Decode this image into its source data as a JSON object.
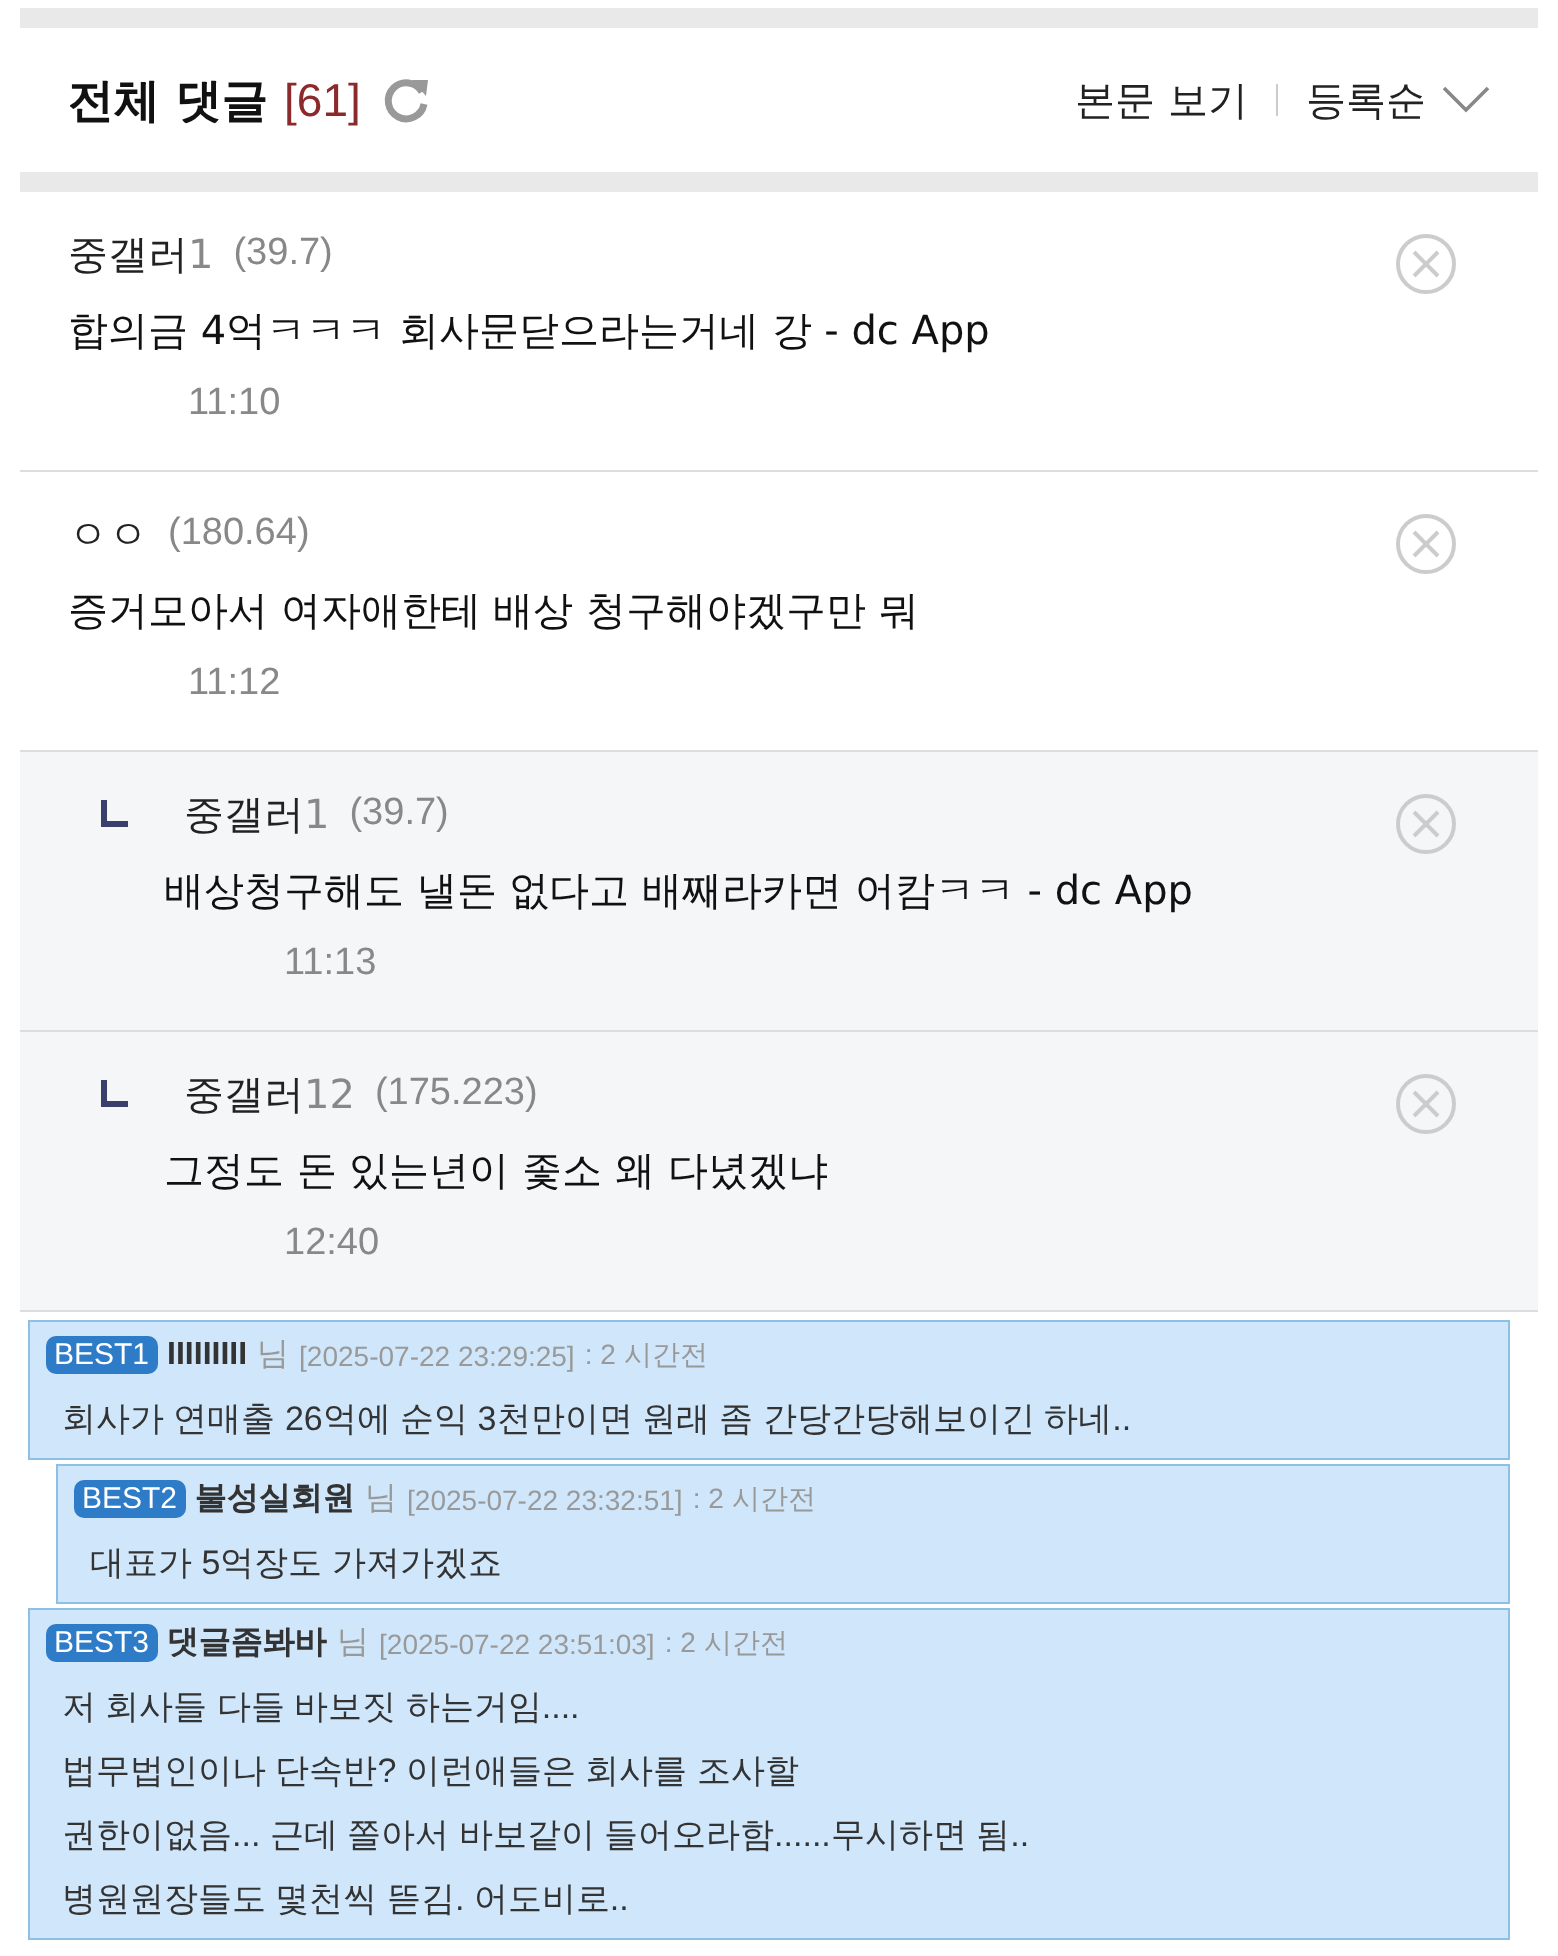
{
  "header": {
    "title": "전체 댓글",
    "count": "[61]",
    "view_post": "본문 보기",
    "sort": "등록순"
  },
  "comments": [
    {
      "name": "중갤러",
      "tag": "1",
      "ip": "(39.7)",
      "text": "합의금 4억ㅋㅋㅋ 회사문닫으라는거네 강 - dc App",
      "time": "11:10"
    },
    {
      "name": "ㅇㅇ",
      "ip": "(180.64)",
      "text": "증거모아서 여자애한테 배상 청구해야겠구만 뭐",
      "time": "11:12",
      "children": [
        {
          "name": "중갤러",
          "tag": "1",
          "ip": "(39.7)",
          "text": "배상청구해도 낼돈 없다고 배째라카면 어캄ㅋㅋ - dc App",
          "time": "11:13"
        },
        {
          "name": "중갤러",
          "tag": "12",
          "ip": "(175.223)",
          "text": "그정도 돈 있는년이 좇소 왜 다녔겠냐",
          "time": "12:40"
        }
      ]
    }
  ],
  "best": [
    {
      "badge": "BEST1",
      "name": "IIIIIIIII",
      "suffix": "님",
      "date": "[2025-07-22 23:29:25]",
      "ago": ": 2 시간전",
      "lines": [
        "회사가 연매출 26억에 순익 3천만이면 원래 좀 간당간당해보이긴 하네.."
      ],
      "children": [
        {
          "badge": "BEST2",
          "name": "불성실회원",
          "suffix": "님",
          "date": "[2025-07-22 23:32:51]",
          "ago": ": 2 시간전",
          "lines": [
            "대표가 5억장도 가져가겠죠"
          ]
        }
      ]
    },
    {
      "badge": "BEST3",
      "name": "댓글좀봐바",
      "suffix": "님",
      "date": "[2025-07-22 23:51:03]",
      "ago": ": 2 시간전",
      "lines": [
        "저 회사들 다들 바보짓 하는거임....",
        "법무법인이나 단속반? 이런애들은 회사를 조사할",
        "권한이없음... 근데 쫄아서 바보같이 들어오라함......무시하면 됨..",
        "병원원장들도 몇천씩 뜯김. 어도비로.."
      ]
    }
  ]
}
